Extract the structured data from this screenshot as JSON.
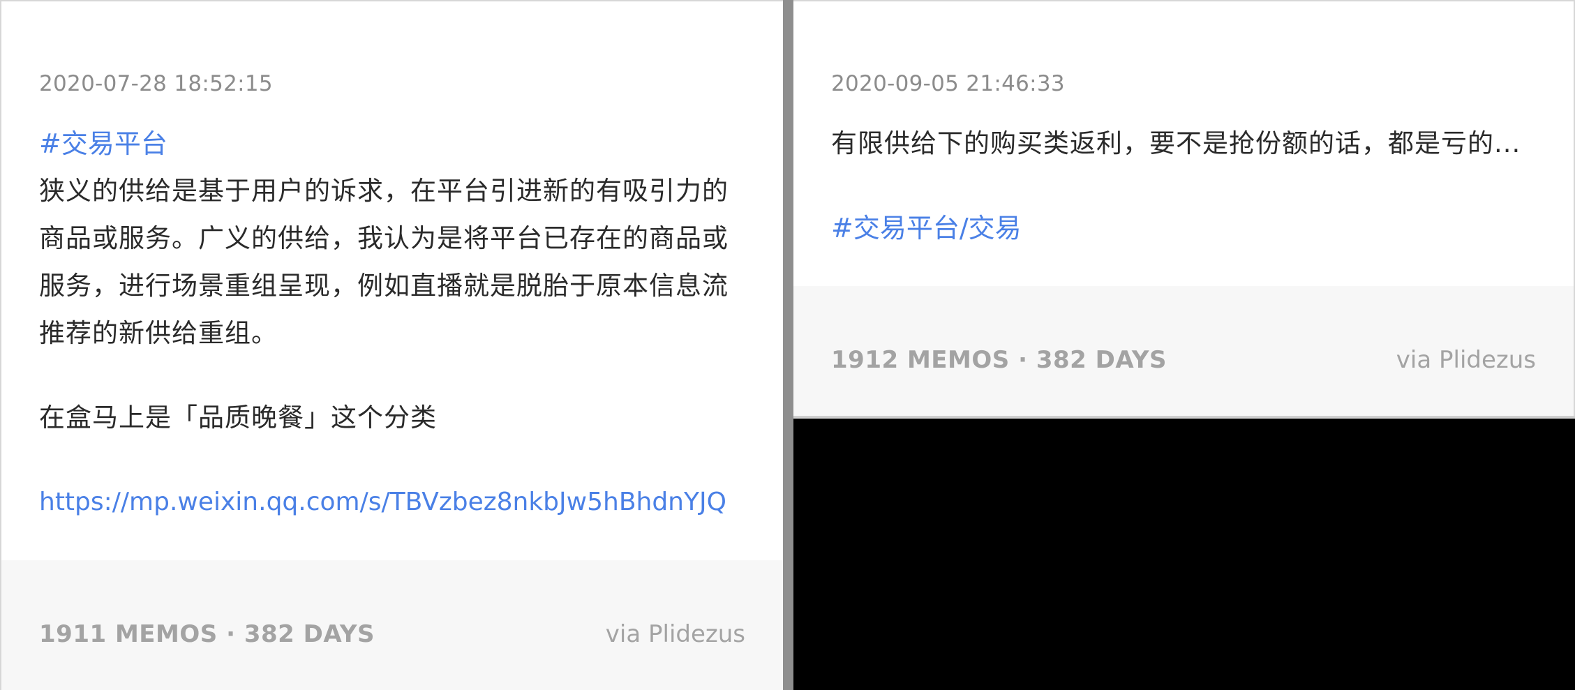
{
  "memos": [
    {
      "timestamp": "2020-07-28 18:52:15",
      "tag": "#交易平台",
      "lines": [
        "狭义的供给是基于用户的诉求，在平台引进新的有吸引力的",
        "商品或服务。广义的供给，我认为是将平台已存在的商品或",
        "服务，进行场景重组呈现，例如直播就是脱胎于原本信息流",
        "推荐的新供给重组。"
      ],
      "paragraph2": "在盒马上是「品质晚餐」这个分类",
      "link": "https://mp.weixin.qq.com/s/TBVzbez8nkbJw5hBhdnYJQ",
      "footer": {
        "stats": "1911 MEMOS · 382 DAYS",
        "via": "via Plidezus"
      }
    },
    {
      "timestamp": "2020-09-05 21:46:33",
      "text": "有限供给下的购买类返利，要不是抢份额的话，都是亏的...",
      "tag": "#交易平台/交易",
      "footer": {
        "stats": "1912 MEMOS · 382 DAYS",
        "via": "via Plidezus"
      }
    }
  ]
}
